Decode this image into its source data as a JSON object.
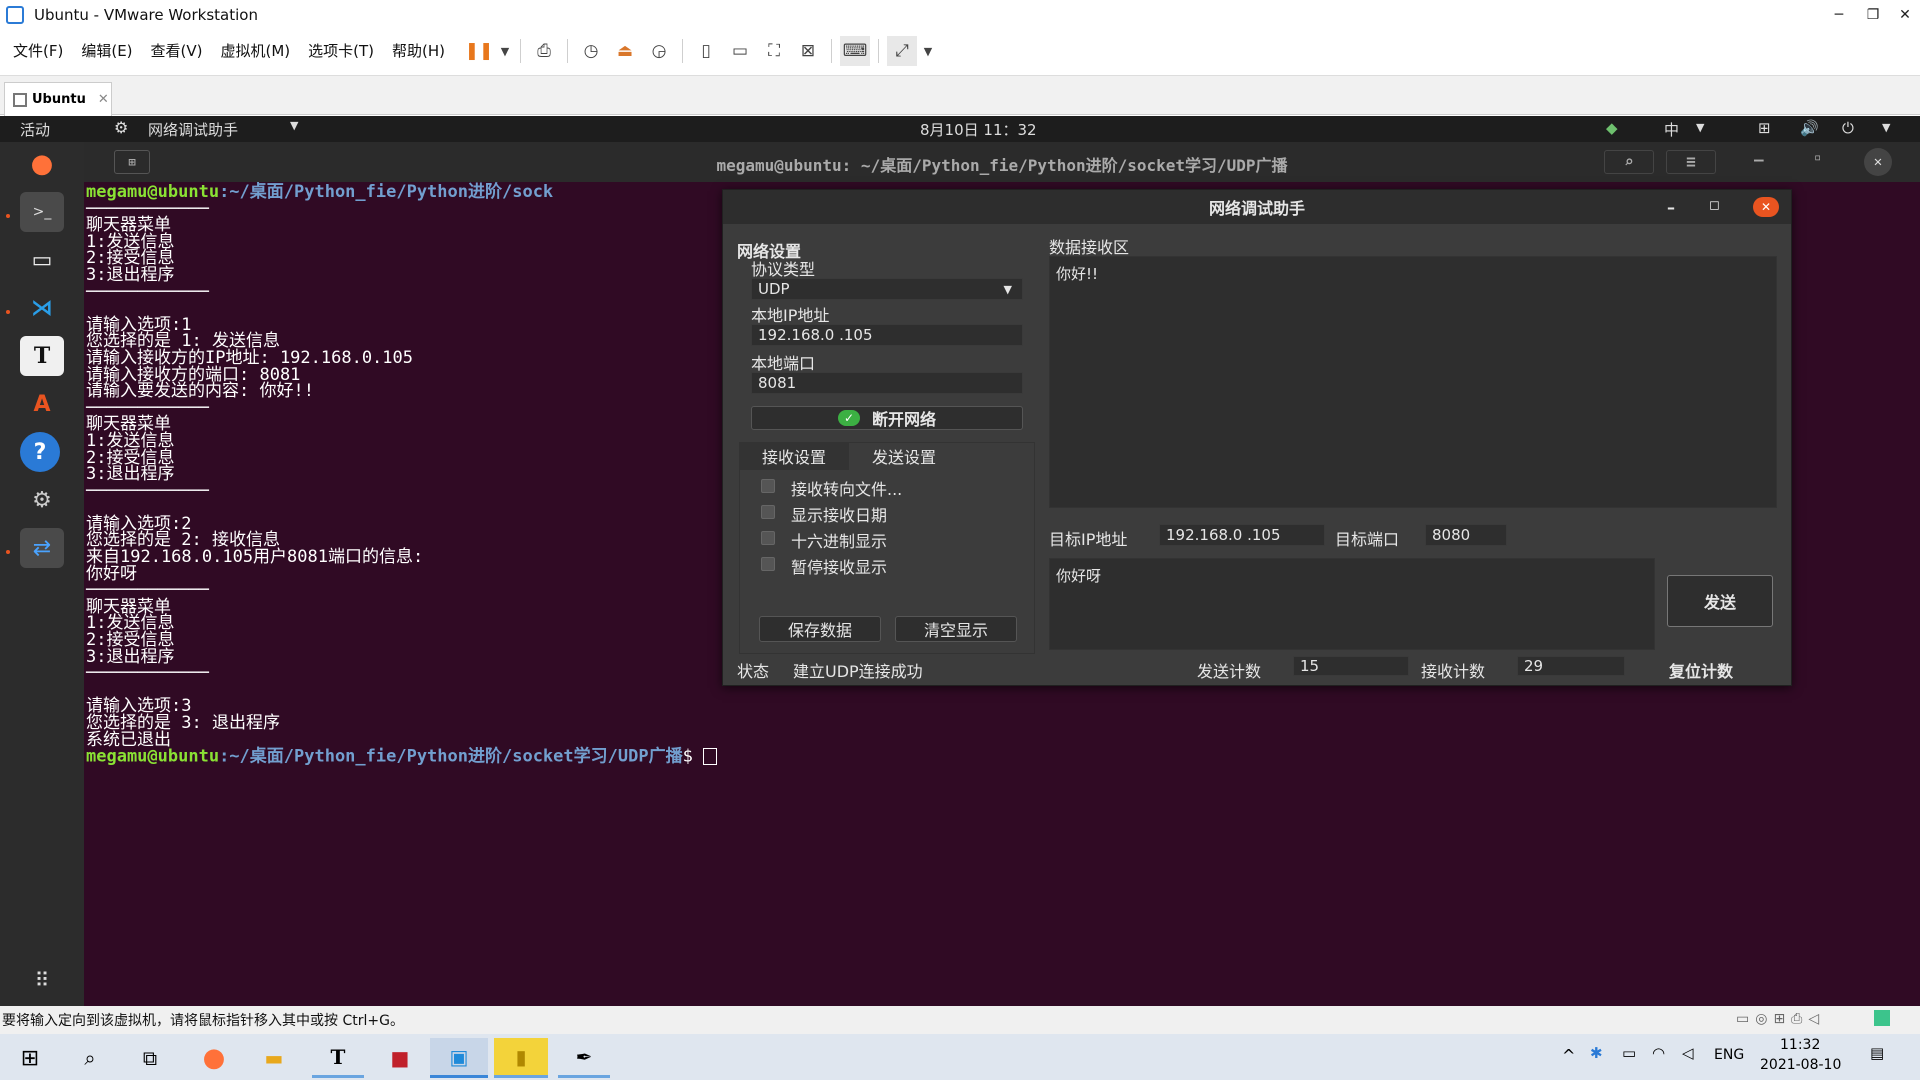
{
  "window": {
    "title": "Ubuntu - VMware Workstation"
  },
  "menu": [
    "文件(F)",
    "编辑(E)",
    "查看(V)",
    "虚拟机(M)",
    "选项卡(T)",
    "帮助(H)"
  ],
  "tab": {
    "label": "Ubuntu"
  },
  "gnome": {
    "activities": "活动",
    "app_name": "网络调试助手",
    "clock": "8月10日  11：32",
    "ime": "中"
  },
  "terminal": {
    "title": "megamu@ubuntu: ~/桌面/Python_fie/Python进阶/socket学习/UDP广播",
    "prompt_user": "megamu@ubuntu",
    "prompt_path": ":~/桌面/Python_fie/Python进阶/socket学习/UDP广播",
    "prompt_suffix": "$ ",
    "first_path_visible": ":~/桌面/Python_fie/Python进阶/sock",
    "rule": "────────────",
    "block1": "聊天器菜单\n1:发送信息\n2:接受信息\n3:退出程序",
    "block2": "请输入选项:1\n您选择的是 1: 发送信息\n请输入接收方的IP地址: 192.168.0.105\n请输入接收方的端口: 8081\n请输入要发送的内容: 你好!!",
    "block3": "聊天器菜单\n1:发送信息\n2:接受信息\n3:退出程序",
    "block4": "请输入选项:2\n您选择的是 2: 接收信息\n来自192.168.0.105用户8081端口的信息:\n你好呀",
    "block5": "聊天器菜单\n1:发送信息\n2:接受信息\n3:退出程序",
    "block6": "请输入选项:3\n您选择的是 3: 退出程序\n系统已退出"
  },
  "netassist": {
    "title": "网络调试助手",
    "network_settings": "网络设置",
    "protocol_label": "协议类型",
    "protocol_value": "UDP",
    "local_ip_label": "本地IP地址",
    "local_ip_value": "192.168.0 .105",
    "local_port_label": "本地端口",
    "local_port_value": "8081",
    "disconnect_button": "断开网络",
    "tab_receive": "接收设置",
    "tab_send": "发送设置",
    "options": [
      "接收转向文件...",
      "显示接收日期",
      "十六进制显示",
      "暂停接收显示"
    ],
    "save_button": "保存数据",
    "clear_button": "清空显示",
    "recv_area_label": "数据接收区",
    "recv_text": "你好!!",
    "target_ip_label": "目标IP地址",
    "target_ip_value": "192.168.0 .105",
    "target_port_label": "目标端口",
    "target_port_value": "8080",
    "send_text": "你好呀",
    "send_button": "发送",
    "status_label": "状态",
    "status_value": "建立UDP连接成功",
    "send_count_label": "发送计数",
    "send_count_value": "15",
    "recv_count_label": "接收计数",
    "recv_count_value": "29",
    "reset_button": "复位计数"
  },
  "vm_status": "要将输入定向到该虚拟机，请将鼠标指针移入其中或按 Ctrl+G。",
  "taskbar": {
    "lang": "ENG",
    "time": "11:32",
    "date": "2021-08-10"
  },
  "colors": {
    "terminal_bg": "#300a24",
    "user_green": "#8ae234",
    "path_blue": "#729fcf",
    "close_orange": "#e95420"
  }
}
